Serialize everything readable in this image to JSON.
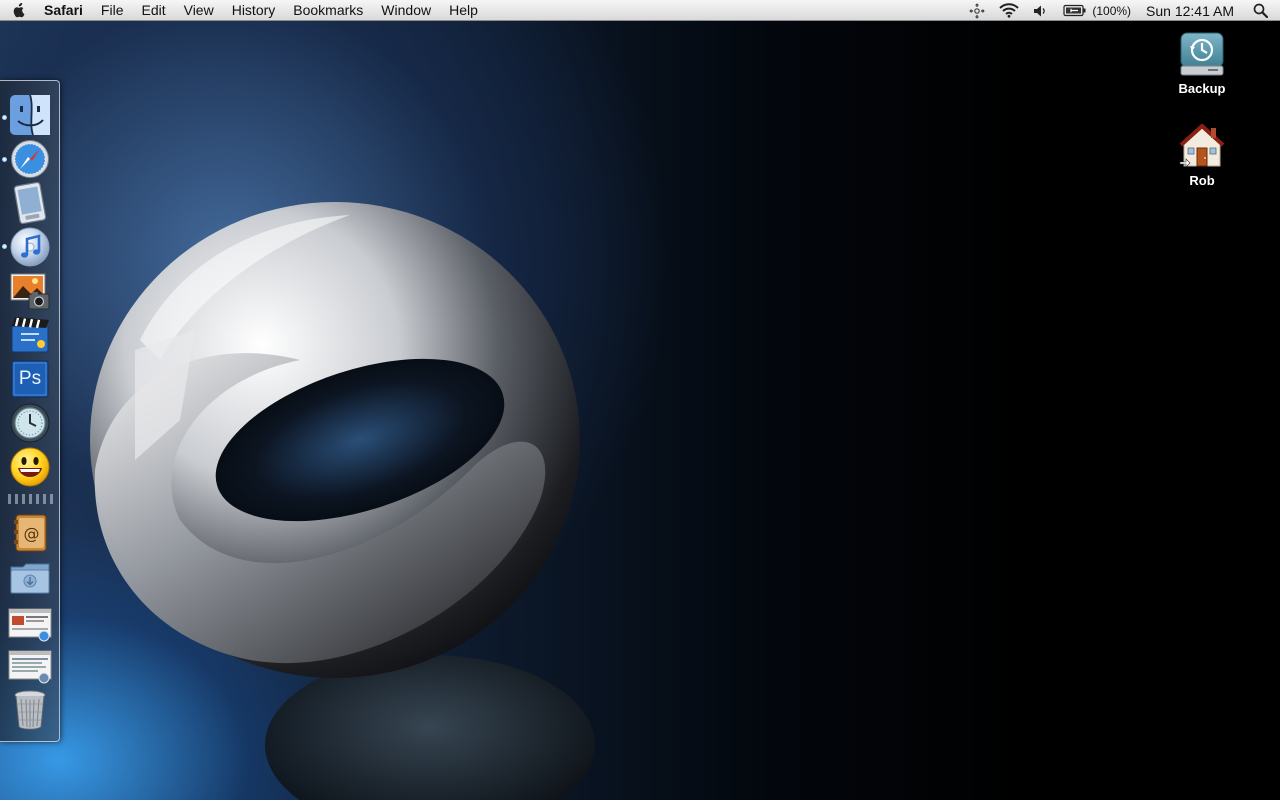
{
  "menubar": {
    "apple_icon": "apple-icon",
    "app_name": "Safari",
    "menus": [
      "File",
      "Edit",
      "View",
      "History",
      "Bookmarks",
      "Window",
      "Help"
    ],
    "status": {
      "sync_icon": "sync-icon",
      "wifi_icon": "wifi-icon",
      "volume_icon": "volume-icon",
      "battery_icon": "battery-icon",
      "battery_percent": "(100%)",
      "clock": "Sun 12:41 AM",
      "spotlight_icon": "spotlight-icon"
    }
  },
  "desktop": {
    "icons": [
      {
        "label": "Backup",
        "icon": "time-machine-drive-icon"
      },
      {
        "label": "Rob",
        "icon": "home-folder-icon"
      }
    ]
  },
  "dock": {
    "apps": [
      {
        "icon": "finder-icon",
        "running": true
      },
      {
        "icon": "safari-icon",
        "running": true
      },
      {
        "icon": "preview-icon",
        "running": false
      },
      {
        "icon": "itunes-icon",
        "running": true
      },
      {
        "icon": "iphoto-icon",
        "running": false
      },
      {
        "icon": "imovie-icon",
        "running": false
      },
      {
        "icon": "photoshop-icon",
        "label": "Ps",
        "running": false
      },
      {
        "icon": "time-machine-icon",
        "running": false
      },
      {
        "icon": "yahoo-messenger-icon",
        "running": false
      }
    ],
    "documents": [
      {
        "icon": "address-book-icon"
      },
      {
        "icon": "downloads-folder-icon"
      },
      {
        "icon": "window-thumbnail-1-icon"
      },
      {
        "icon": "window-thumbnail-2-icon"
      },
      {
        "icon": "trash-icon"
      }
    ]
  },
  "colors": {
    "menubar_top": "#f6f6f6",
    "menubar_bottom": "#d9d9d9",
    "wallpaper_blue": "#2f6fb8",
    "wallpaper_dark": "#000000"
  }
}
